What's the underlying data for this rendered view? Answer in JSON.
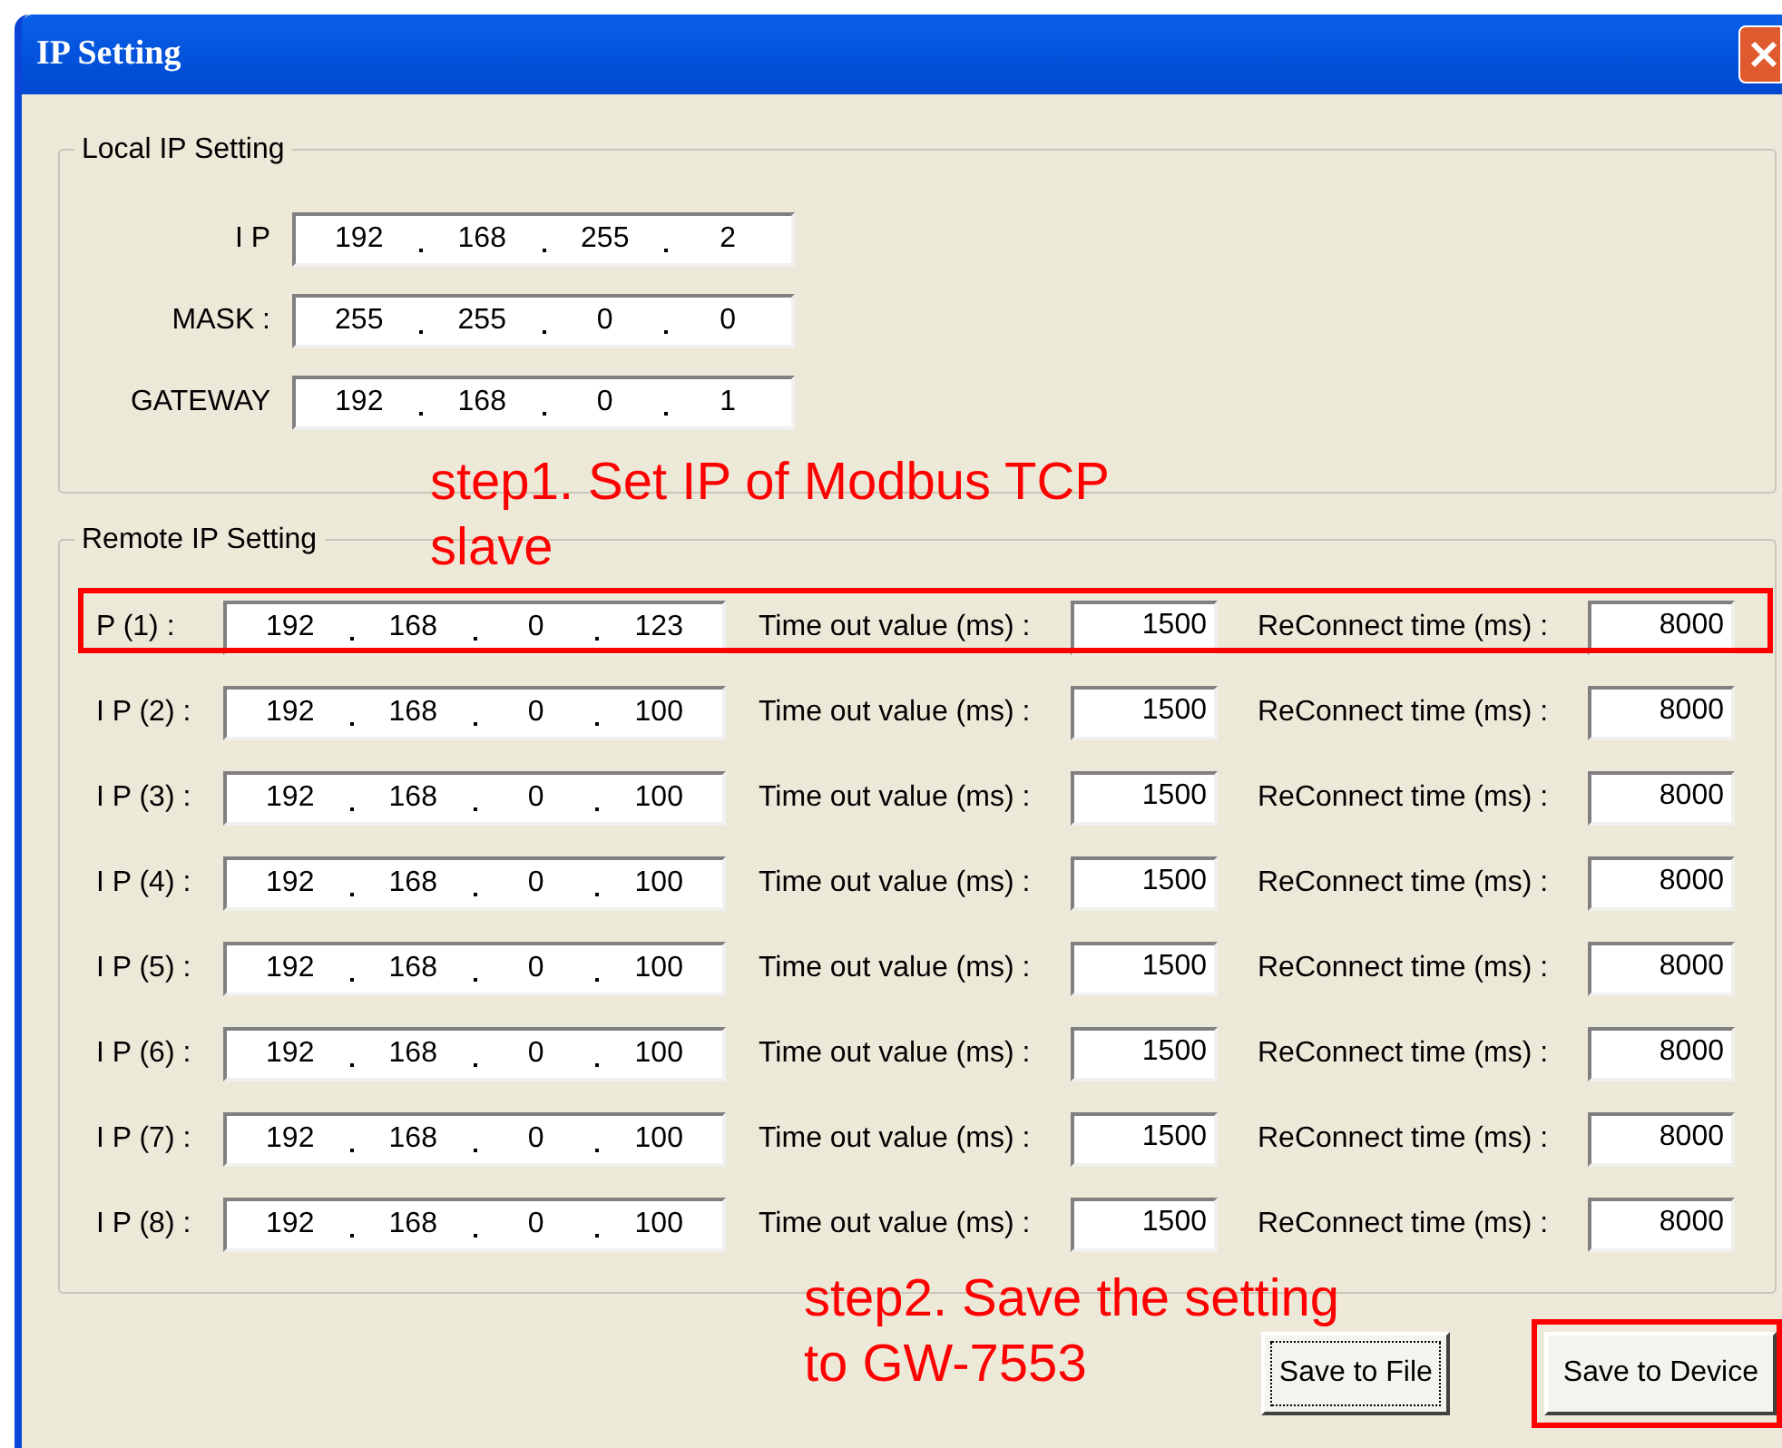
{
  "window": {
    "title": "IP Setting"
  },
  "local": {
    "title": "Local IP Setting",
    "rows": [
      {
        "label": "I P",
        "octets": [
          "192",
          "168",
          "255",
          "2"
        ]
      },
      {
        "label": "MASK :",
        "octets": [
          "255",
          "255",
          "0",
          "0"
        ]
      },
      {
        "label": "GATEWAY",
        "octets": [
          "192",
          "168",
          "0",
          "1"
        ]
      }
    ]
  },
  "remote": {
    "title": "Remote IP Setting",
    "rows": [
      {
        "label": "P (1) :",
        "octets": [
          "192",
          "168",
          "0",
          "123"
        ],
        "timeout_label": "Time out value (ms) :",
        "timeout": "1500",
        "reconnect_label": "ReConnect time (ms) :",
        "reconnect": "8000",
        "highlighted": true
      },
      {
        "label": "I P (2) :",
        "octets": [
          "192",
          "168",
          "0",
          "100"
        ],
        "timeout_label": "Time out value (ms) :",
        "timeout": "1500",
        "reconnect_label": "ReConnect time (ms) :",
        "reconnect": "8000",
        "highlighted": false
      },
      {
        "label": "I P (3) :",
        "octets": [
          "192",
          "168",
          "0",
          "100"
        ],
        "timeout_label": "Time out value (ms) :",
        "timeout": "1500",
        "reconnect_label": "ReConnect time (ms) :",
        "reconnect": "8000",
        "highlighted": false
      },
      {
        "label": "I P (4) :",
        "octets": [
          "192",
          "168",
          "0",
          "100"
        ],
        "timeout_label": "Time out value (ms) :",
        "timeout": "1500",
        "reconnect_label": "ReConnect time (ms) :",
        "reconnect": "8000",
        "highlighted": false
      },
      {
        "label": "I P (5) :",
        "octets": [
          "192",
          "168",
          "0",
          "100"
        ],
        "timeout_label": "Time out value (ms) :",
        "timeout": "1500",
        "reconnect_label": "ReConnect time (ms) :",
        "reconnect": "8000",
        "highlighted": false
      },
      {
        "label": "I P (6) :",
        "octets": [
          "192",
          "168",
          "0",
          "100"
        ],
        "timeout_label": "Time out value (ms) :",
        "timeout": "1500",
        "reconnect_label": "ReConnect time (ms) :",
        "reconnect": "8000",
        "highlighted": false
      },
      {
        "label": "I P (7) :",
        "octets": [
          "192",
          "168",
          "0",
          "100"
        ],
        "timeout_label": "Time out value (ms) :",
        "timeout": "1500",
        "reconnect_label": "ReConnect time (ms) :",
        "reconnect": "8000",
        "highlighted": false
      },
      {
        "label": "I P (8) :",
        "octets": [
          "192",
          "168",
          "0",
          "100"
        ],
        "timeout_label": "Time out value (ms) :",
        "timeout": "1500",
        "reconnect_label": "ReConnect time (ms) :",
        "reconnect": "8000",
        "highlighted": false
      }
    ]
  },
  "buttons": [
    {
      "label": "Save to File",
      "focused": true,
      "highlighted": false
    },
    {
      "label": "Save to Device",
      "focused": false,
      "highlighted": true
    }
  ],
  "annotations": [
    {
      "lines": [
        "step1. Set IP of Modbus TCP",
        "slave"
      ]
    },
    {
      "lines": [
        "step2. Save the setting",
        "to GW-7553"
      ]
    }
  ]
}
